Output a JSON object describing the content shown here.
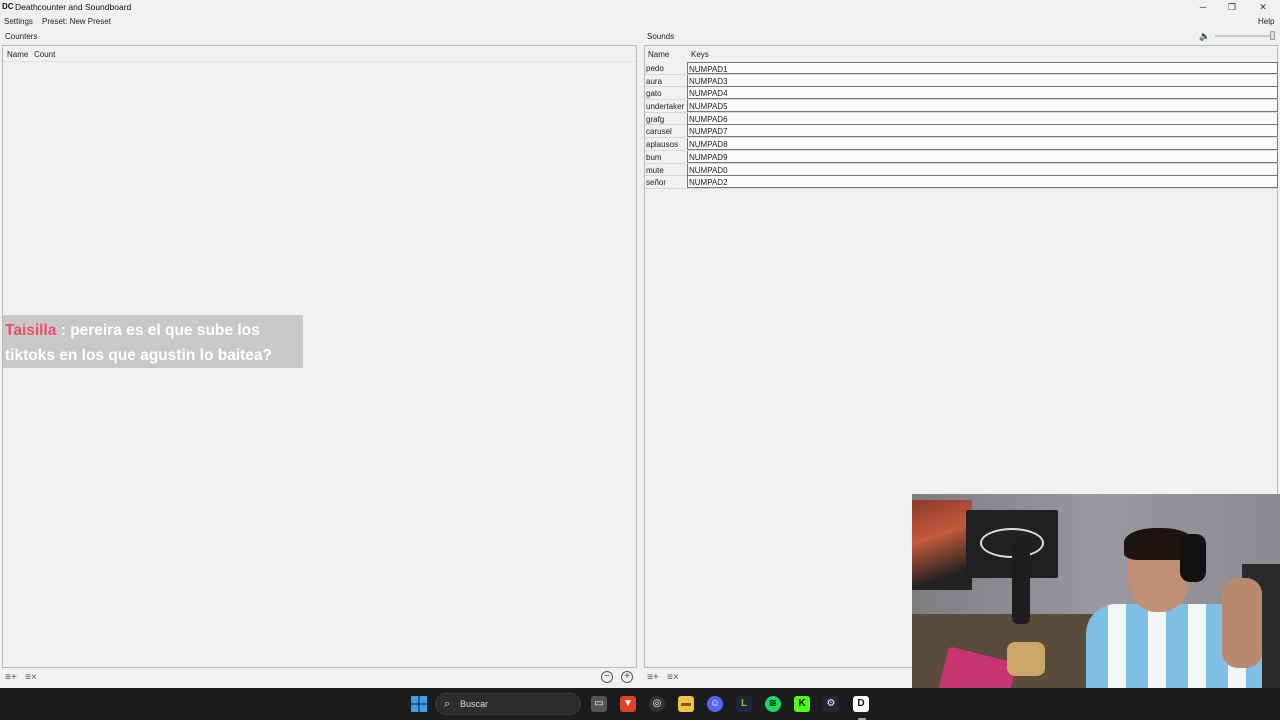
{
  "window": {
    "title": "Deathcounter and Soundboard",
    "icon_label": "DC",
    "controls": {
      "minimize": "─",
      "restore": "❐",
      "close": "✕"
    }
  },
  "menu": {
    "settings": "Settings",
    "preset": "Preset: New Preset",
    "help": "Help"
  },
  "counters": {
    "panel_label": "Counters",
    "columns": {
      "name": "Name",
      "count": "Count"
    },
    "rows": []
  },
  "sounds": {
    "panel_label": "Sounds",
    "columns": {
      "name": "Name",
      "keys": "Keys"
    },
    "rows": [
      {
        "name": "pedo",
        "key": "NUMPAD1"
      },
      {
        "name": "aura",
        "key": "NUMPAD3"
      },
      {
        "name": "gato",
        "key": "NUMPAD4"
      },
      {
        "name": "undertaker",
        "key": "NUMPAD5"
      },
      {
        "name": "grafg",
        "key": "NUMPAD6"
      },
      {
        "name": "carusel",
        "key": "NUMPAD7"
      },
      {
        "name": "aplausos",
        "key": "NUMPAD8"
      },
      {
        "name": "bum",
        "key": "NUMPAD9"
      },
      {
        "name": "mute",
        "key": "NUMPAD0"
      },
      {
        "name": "señor",
        "key": "NUMPAD2"
      }
    ]
  },
  "chat_overlay": {
    "user": "Taisilla",
    "separator": " : ",
    "message_line1": "pereira es el que sube los",
    "message_line2": "tiktoks en los que agustin lo baitea?"
  },
  "taskbar": {
    "search_placeholder": "Buscar",
    "pinned": [
      "windows-start-icon",
      "search-icon",
      "task-view-icon",
      "brave-browser-icon",
      "obs-icon",
      "file-explorer-icon",
      "discord-icon",
      "league-client-icon",
      "spotify-icon",
      "kick-icon",
      "steam-icon",
      "deathcounter-app-icon"
    ]
  },
  "colors": {
    "chat_user": "#e8506e",
    "taskbar_bg": "#1c1c1c",
    "windows_blue": "#2b8fe0"
  }
}
